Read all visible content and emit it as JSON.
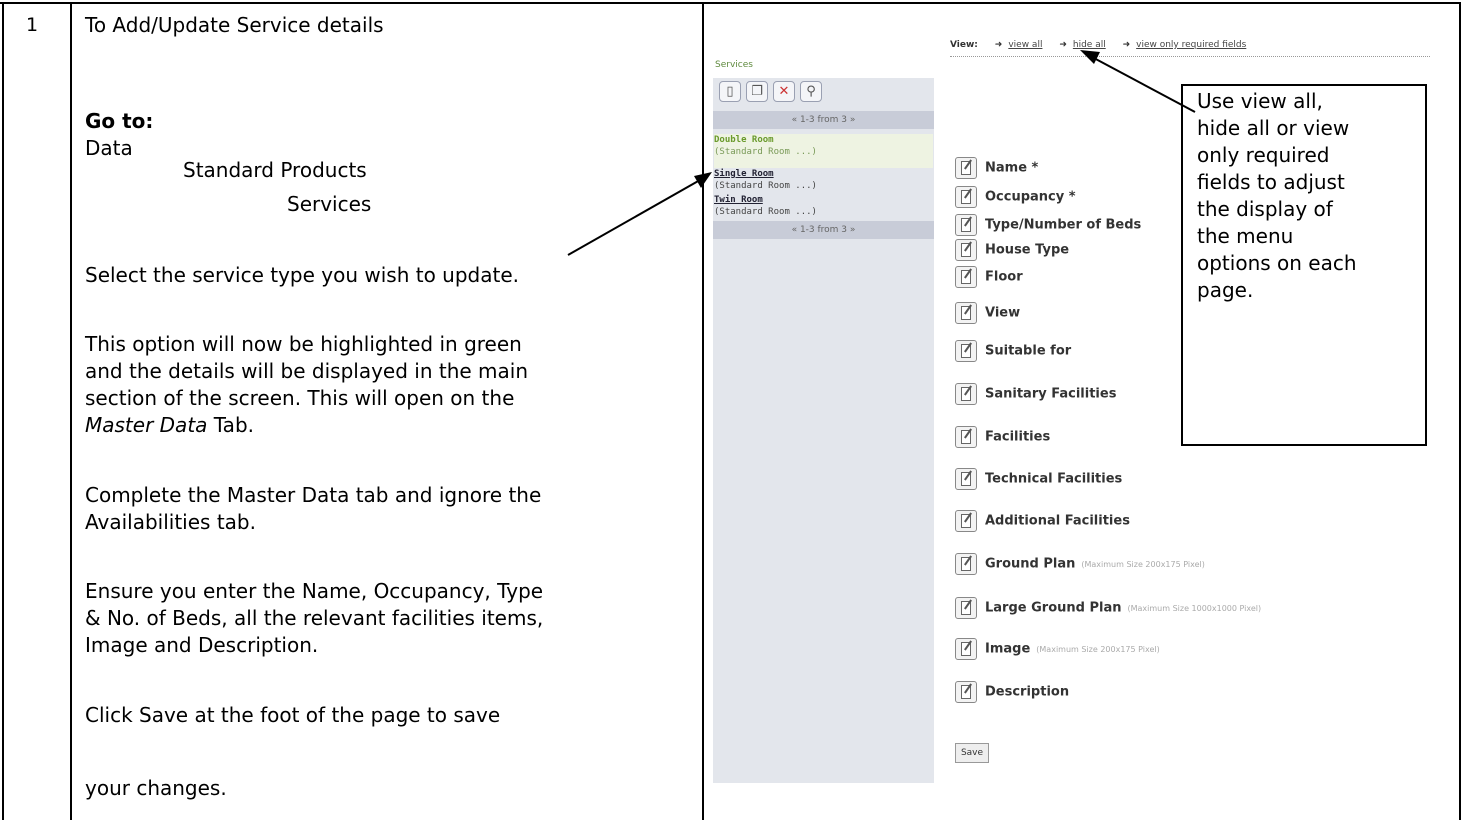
{
  "step": {
    "number": "1"
  },
  "instructions": {
    "title": "To Add/Update Service details",
    "goto_label": "Go to:",
    "path": [
      "Data",
      "Standard Products",
      "Services"
    ],
    "select": "Select the service type you wish to update.",
    "highlight_lines": [
      "This option will now be highlighted in green",
      "and the details will be displayed in the main",
      "section of the screen.  This will open on the"
    ],
    "tab_name": "Master Data",
    "tab_suffix": " Tab.",
    "complete_lines": [
      "Complete the Master Data tab and ignore the",
      "Availabilities tab."
    ],
    "ensure_lines": [
      "Ensure you enter the Name, Occupancy, Type",
      "& No. of Beds, all the relevant facilities items,",
      "Image and Description."
    ],
    "save_lines": [
      "Click Save at the foot of the page to save",
      "your changes."
    ]
  },
  "screenshot": {
    "sidebar_title": "Services",
    "toolbar_icons": [
      "new-icon",
      "copy-icon",
      "delete-icon",
      "search-icon"
    ],
    "pager_text": "« 1-3 from 3 »",
    "rooms": [
      {
        "name": "Double Room",
        "sub": "(Standard Room ...)",
        "selected": true
      },
      {
        "name": "Single Room",
        "sub": "(Standard Room ...)",
        "selected": false
      },
      {
        "name": "Twin Room",
        "sub": "(Standard Room ...)",
        "selected": false
      }
    ],
    "view_label": "View:",
    "view_links": [
      "view all",
      "hide all",
      "view only required fields"
    ],
    "fields": [
      {
        "label": "Name *",
        "note": ""
      },
      {
        "label": "Occupancy *",
        "note": ""
      },
      {
        "label": "Type/Number of Beds",
        "note": ""
      },
      {
        "label": "House Type",
        "note": ""
      },
      {
        "label": "Floor",
        "note": ""
      },
      {
        "label": "View",
        "note": ""
      },
      {
        "label": "Suitable for",
        "note": ""
      },
      {
        "label": "Sanitary Facilities",
        "note": ""
      },
      {
        "label": "Facilities",
        "note": ""
      },
      {
        "label": "Technical Facilities",
        "note": ""
      },
      {
        "label": "Additional Facilities",
        "note": ""
      },
      {
        "label": "Ground Plan",
        "note": "(Maximum Size 200x175 Pixel)"
      },
      {
        "label": "Large Ground Plan",
        "note": "(Maximum Size 1000x1000 Pixel)"
      },
      {
        "label": "Image",
        "note": "(Maximum Size 200x175 Pixel)"
      },
      {
        "label": "Description",
        "note": ""
      }
    ],
    "save_label": "Save"
  },
  "callout": {
    "lines": [
      "Use view all,",
      "hide all or view",
      "only required",
      "fields to adjust",
      "the display of",
      "the menu",
      "options on each",
      "page."
    ]
  }
}
